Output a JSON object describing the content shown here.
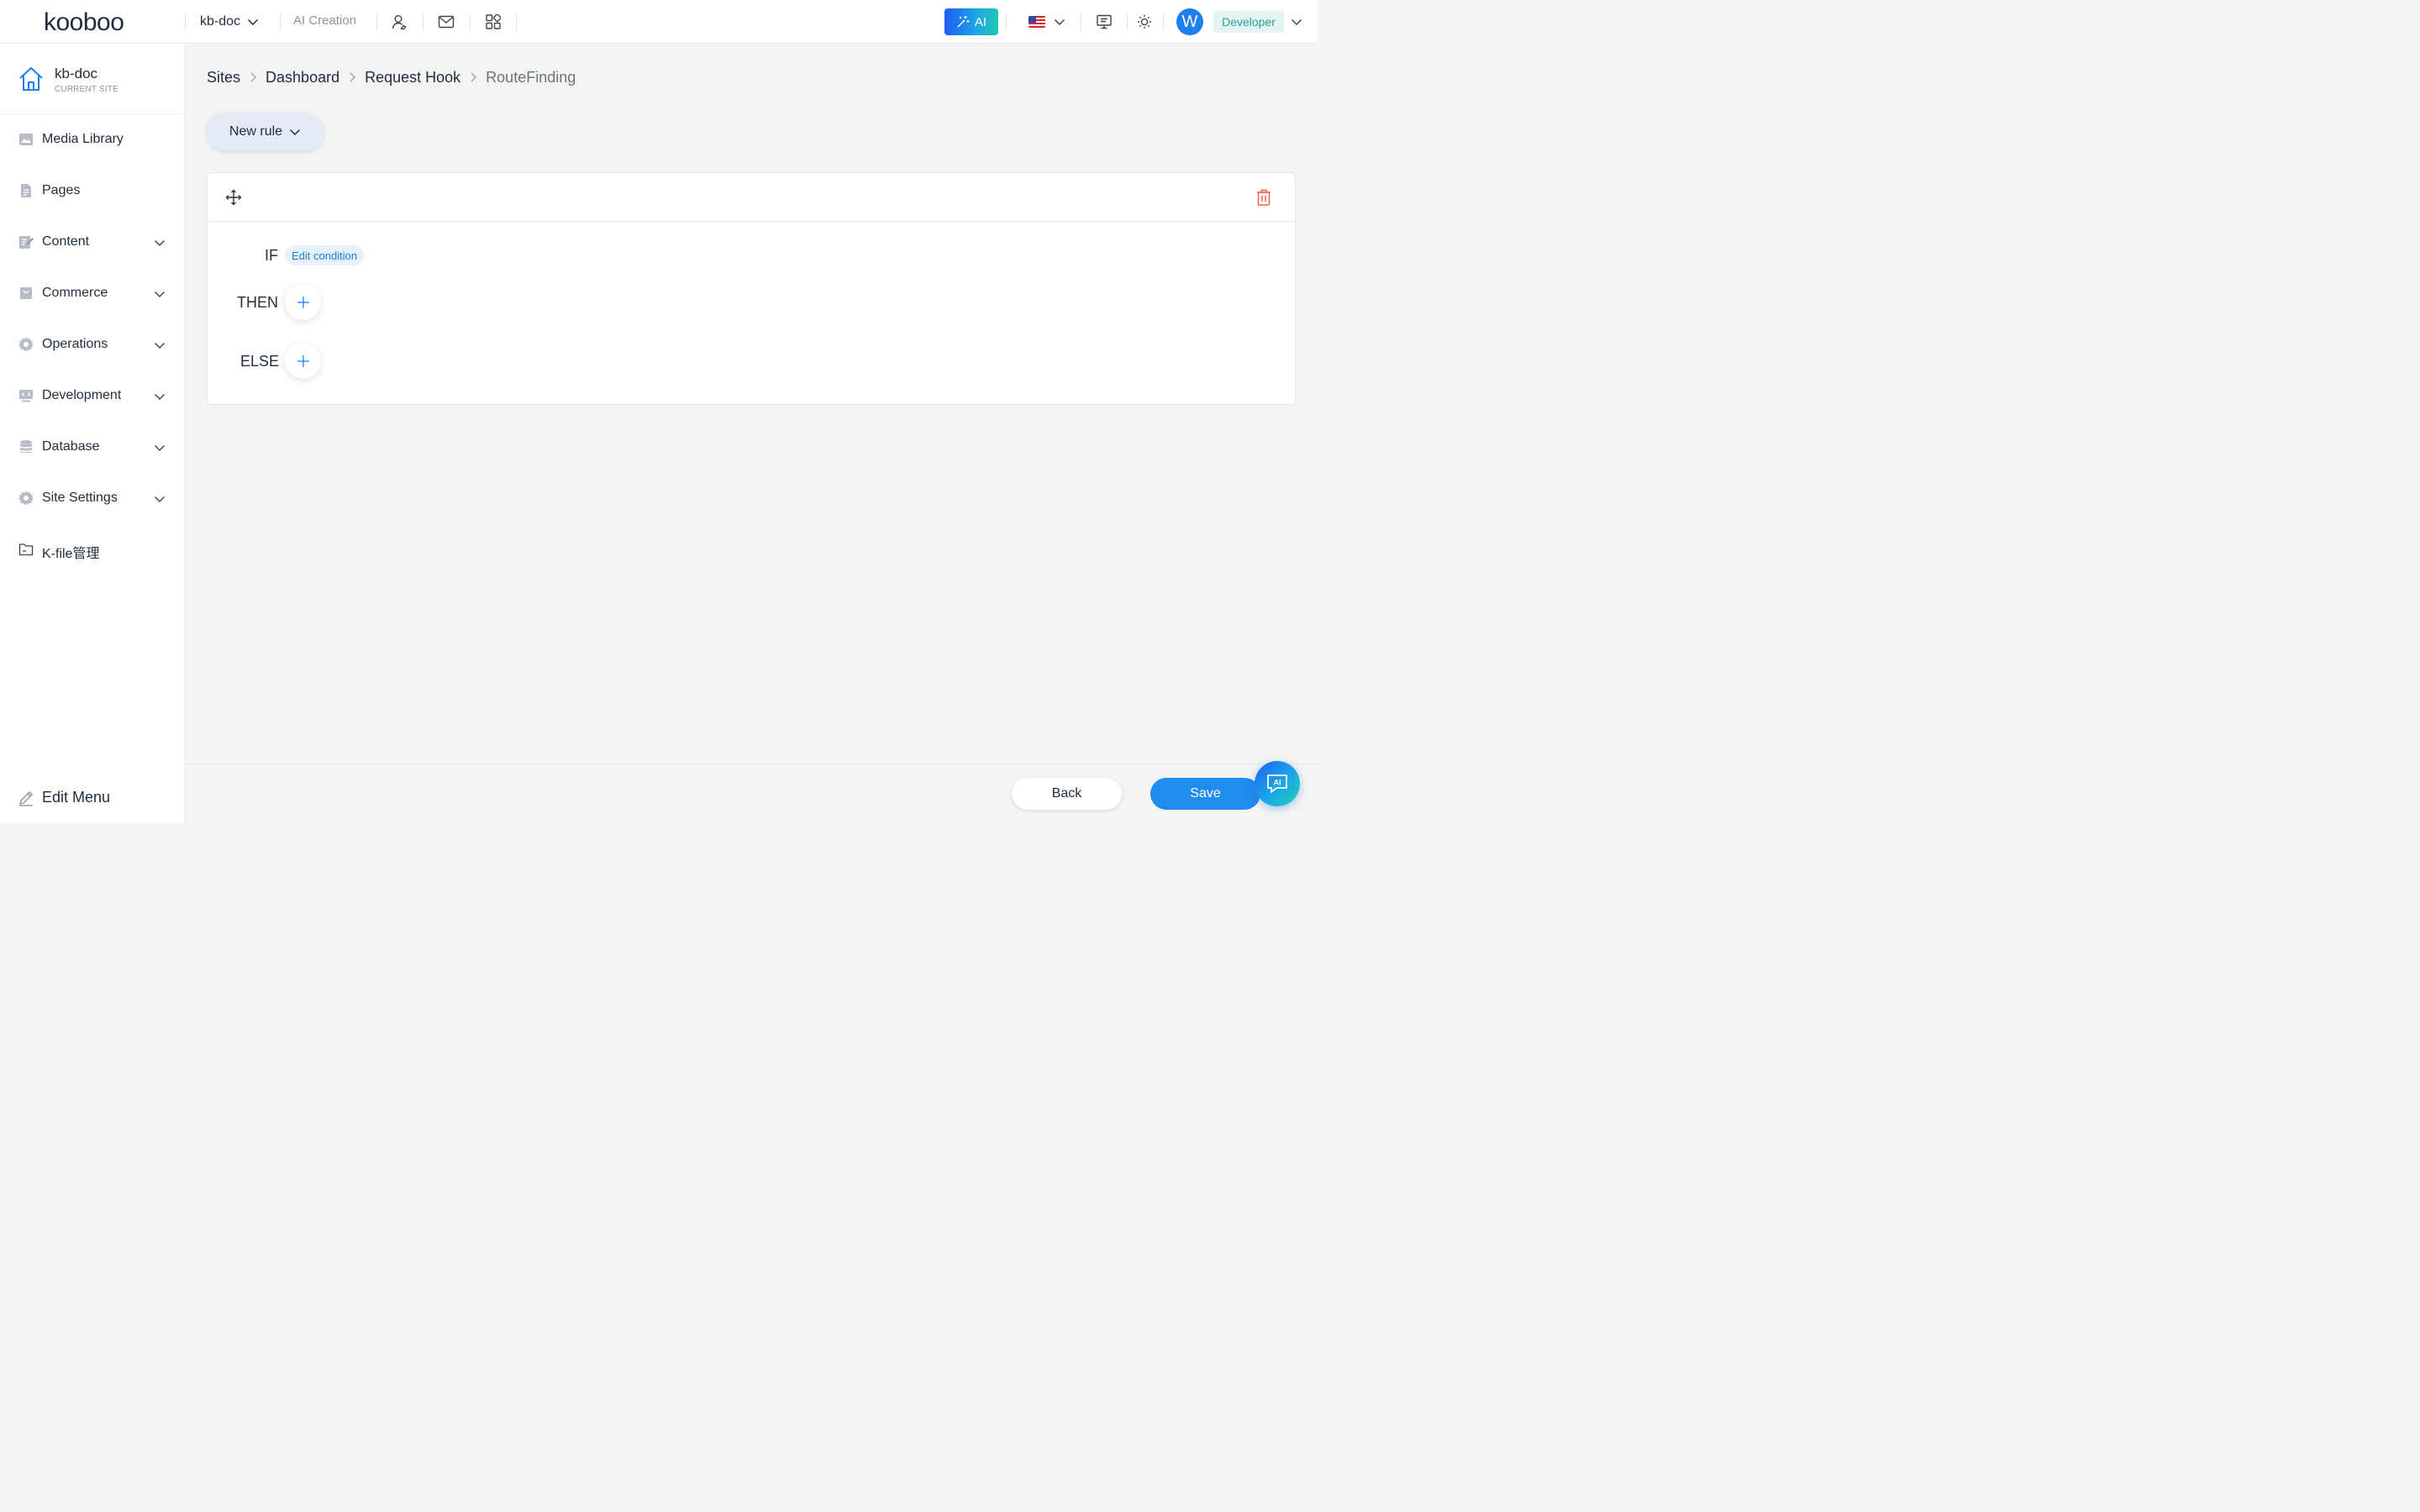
{
  "header": {
    "logo_text": "kooboo",
    "site_switcher": "kb-doc",
    "ai_creation": "AI Creation",
    "ai_button": "AI",
    "user_initial": "W",
    "role": "Developer"
  },
  "sidebar": {
    "current_site": {
      "name": "kb-doc",
      "subtitle": "CURRENT SITE"
    },
    "items": [
      {
        "label": "Media Library",
        "icon": "image-icon",
        "expandable": false
      },
      {
        "label": "Pages",
        "icon": "page-icon",
        "expandable": false
      },
      {
        "label": "Content",
        "icon": "content-icon",
        "expandable": true
      },
      {
        "label": "Commerce",
        "icon": "bag-icon",
        "expandable": true
      },
      {
        "label": "Operations",
        "icon": "gear-icon",
        "expandable": true
      },
      {
        "label": "Development",
        "icon": "code-icon",
        "expandable": true
      },
      {
        "label": "Database",
        "icon": "database-icon",
        "expandable": true
      },
      {
        "label": "Site Settings",
        "icon": "gear-icon",
        "expandable": true
      },
      {
        "label": "K-file管理",
        "icon": "folder-icon",
        "expandable": false
      }
    ],
    "edit_menu": "Edit Menu"
  },
  "breadcrumb": [
    "Sites",
    "Dashboard",
    "Request Hook",
    "RouteFinding"
  ],
  "toolbar": {
    "new_rule": "New rule"
  },
  "rule": {
    "if_label": "IF",
    "edit_condition": "Edit condition",
    "then_label": "THEN",
    "else_label": "ELSE"
  },
  "footer": {
    "back": "Back",
    "save": "Save",
    "ai_chat": "AI"
  },
  "colors": {
    "accent": "#1f8cee",
    "danger": "#f0643c",
    "role_bg": "#e4f4f2",
    "role_text": "#25a494"
  }
}
